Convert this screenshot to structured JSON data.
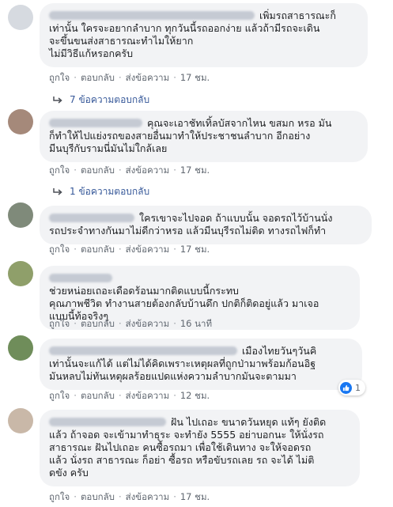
{
  "comments": [
    {
      "text_lines": [
        "เพิ่มรถสาธารณะก็",
        "เท่านั้น ใครจะอยากลำบาก ทุกวันนี้รถออกง่าย แล้วถ้ามีรถจะเดิน",
        "จะขึ้นขนส่งสาธารณะทำไมให้ยาก",
        "ไม่มีวิธีแก้หรอกครับ"
      ],
      "actions": {
        "like": "ถูกใจ",
        "reply": "ตอบกลับ",
        "message": "ส่งข้อความ",
        "time": "17 ชม."
      },
      "replies": "7 ข้อความตอบกลับ"
    },
    {
      "text_lines": [
        "คุณจะเอาชัทเทิ้ลบัสจากไหน ขสมก หรอ มัน",
        "ก็ทำให้ไปแย่งรถของสายอื่นมาทำให้ประชาชนลำบาก อีกอย่าง",
        "มีนบุรีกับรามนี่มันไม่ใกล้เลย"
      ],
      "actions": {
        "like": "ถูกใจ",
        "reply": "ตอบกลับ",
        "message": "ส่งข้อความ",
        "time": "17 ชม."
      },
      "replies": "1 ข้อความตอบกลับ"
    },
    {
      "text_lines": [
        "ใครเขาจะไปจอด ถ้าแบบนั้น จอดรถไว้บ้านนั่ง",
        "รถประจำทางกันมาไม่ดีกว่าหรอ แล้วมีนบุรีรถไม่ติด ทางรถไฟก็ทำ"
      ],
      "actions": {
        "like": "ถูกใจ",
        "reply": "ตอบกลับ",
        "message": "ส่งข้อความ",
        "time": "17 ชม."
      }
    },
    {
      "text_lines": [
        "ช่วยหน่อยเถอะเดือดร้อนมากติดแบบนี้กระทบ",
        "คุณภาพชีวิต ทำงานสายต้องกลับบ้านดึก ปกติก็ติดอยู่แล้ว มาเจอ",
        "แบบนี้ท้อจริงๆ"
      ],
      "actions": {
        "like": "ถูกใจ",
        "reply": "ตอบกลับ",
        "message": "ส่งข้อความ",
        "time": "16 นาที"
      }
    },
    {
      "text_lines": [
        "เมืองไทยวันๆวันคิ",
        "เท่านั้นจะแก้ได้ แต่ไม่ได้คิดเพราะเหตุผลที่ถูกป่ามาพร้อมก้อนอิฐ",
        "มันหลบไม่ทันเหตุผลร้อยแปดแห่งความลำบากมันจะตามมา"
      ],
      "actions": {
        "like": "ถูกใจ",
        "reply": "ตอบกลับ",
        "message": "ส่งข้อความ",
        "time": "12 ชม."
      },
      "reaction_count": "1"
    },
    {
      "text_lines": [
        "ฝัน ไปเถอะ ขนาดวันหยุด แท้ๆ ยังติด",
        "แล้ว ถ้าจอด จะเข้ามาทำธุระ จะทำยัง 5555 อย่าบอกนะ ให้นั่งรถ",
        "สาธารณะ ฝันไปเถอะ คนซื้อรถมา เพื่อใช้เดินทาง จะให้จอดรถ",
        "แล้ว นั่งรถ สาธารณะ ก็อย่า ซื้อรถ หรือขับรถเลย รถ จะได้ ไม่ติ",
        "ดขัง ครับ"
      ],
      "actions": {
        "like": "ถูกใจ",
        "reply": "ตอบกลับ",
        "message": "ส่งข้อความ",
        "time": "17 ชม."
      }
    }
  ],
  "colors": {
    "bubble": "#f2f3f5",
    "link": "#365899",
    "meta": "#606770",
    "like": "#1877f2"
  }
}
